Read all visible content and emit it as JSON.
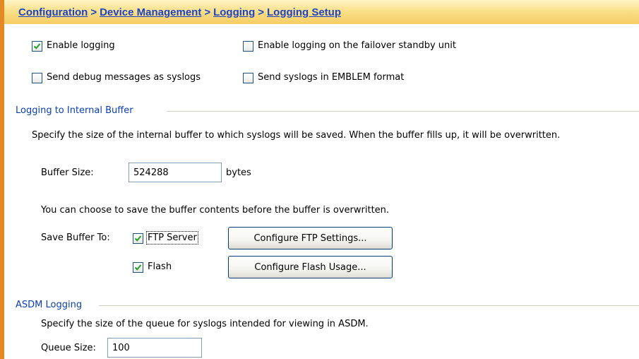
{
  "breadcrumb": {
    "items": [
      "Configuration",
      "Device Management",
      "Logging",
      "Logging Setup"
    ],
    "separator": ">"
  },
  "options": {
    "enable_logging": {
      "label": "Enable logging",
      "checked": true
    },
    "enable_logging_standby": {
      "label": "Enable logging on the failover standby unit",
      "checked": false
    },
    "send_debug": {
      "label": "Send debug messages as syslogs",
      "checked": false
    },
    "emblem_format": {
      "label": "Send syslogs in EMBLEM format",
      "checked": false
    }
  },
  "internal_buffer": {
    "title": "Logging to Internal Buffer",
    "description": "Specify the size of the internal buffer to which syslogs will be saved. When the buffer fills up, it will be overwritten.",
    "buffer_size_label": "Buffer Size:",
    "buffer_size_value": "524288",
    "buffer_size_unit": "bytes",
    "save_description": "You can choose to save the buffer contents before the buffer is overwritten.",
    "save_label": "Save Buffer To:",
    "ftp": {
      "label": "FTP Server",
      "checked": true,
      "button_label": "Configure FTP Settings..."
    },
    "flash": {
      "label": "Flash",
      "checked": true,
      "button_label": "Configure Flash Usage..."
    }
  },
  "asdm_logging": {
    "title": "ASDM Logging",
    "description": "Specify the size of the queue for syslogs intended for viewing in ASDM.",
    "queue_size_label": "Queue Size:",
    "queue_size_value": "100"
  },
  "colors": {
    "breadcrumb": "#1c44c8",
    "header_top": "#fff4c4",
    "header_bottom": "#f6cc64",
    "left_border": "#e48a24",
    "section_title": "#0a3fb0",
    "checkmark": "#21a121"
  }
}
